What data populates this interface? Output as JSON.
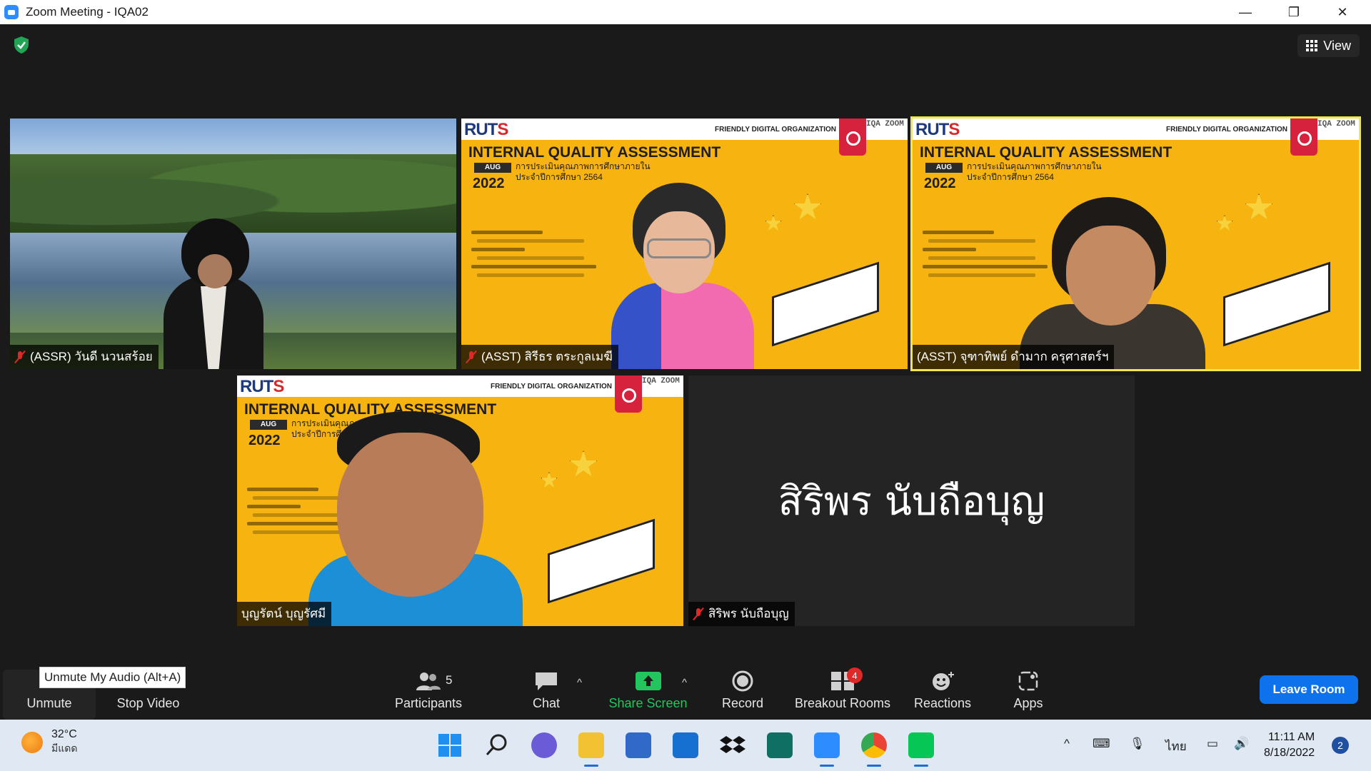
{
  "window": {
    "title": "Zoom Meeting - IQA02",
    "minimize": "—",
    "maximize": "❐",
    "close": "✕"
  },
  "top": {
    "view_label": "View"
  },
  "tiles": [
    {
      "name": "(ASSR) วันดี นวนสร้อย",
      "muted": true
    },
    {
      "name": "(ASST) สิรีธร ตระกูลเมฆี",
      "muted": true
    },
    {
      "name": "(ASST) จุฑาทิพย์ ดำมาก ครุศาสตร์ฯ",
      "muted": false
    },
    {
      "name": "บุญรัตน์ บุญรัศมี",
      "muted": false
    },
    {
      "name": "สิริพร นับถือบุญ",
      "muted": true,
      "display_name": "สิริพร นับถือบุญ"
    }
  ],
  "slide": {
    "logo_r": "RUT",
    "logo_s": "S",
    "fdo": "FRIENDLY DIGITAL ORGANIZATION",
    "iqa": "IQA ZOOM",
    "heading": "INTERNAL QUALITY ASSESSMENT",
    "sub1": "การประเมินคุณภาพการศึกษาภายใน",
    "sub2": "ประจำปีการศึกษา 2564",
    "month": "AUG",
    "year": "2022"
  },
  "toolbar": {
    "tooltip": "Unmute My Audio (Alt+A)",
    "unmute": "Unmute",
    "stop_video": "Stop Video",
    "participants": "Participants",
    "participants_count": "5",
    "chat": "Chat",
    "share_screen": "Share Screen",
    "record": "Record",
    "breakout_rooms": "Breakout Rooms",
    "breakout_badge": "4",
    "reactions": "Reactions",
    "apps": "Apps",
    "leave": "Leave Room"
  },
  "taskbar": {
    "temp": "32°C",
    "weather": "มีแดด",
    "lang": "ไทย",
    "time": "11:11 AM",
    "date": "8/18/2022",
    "notifications": "2"
  },
  "colors": {
    "zoom_blue": "#2D8CFF",
    "leave_blue": "#0e72ed",
    "active_speaker": "#f0e74d",
    "slide_yellow": "#f7b310",
    "share_green": "#22c55e"
  }
}
